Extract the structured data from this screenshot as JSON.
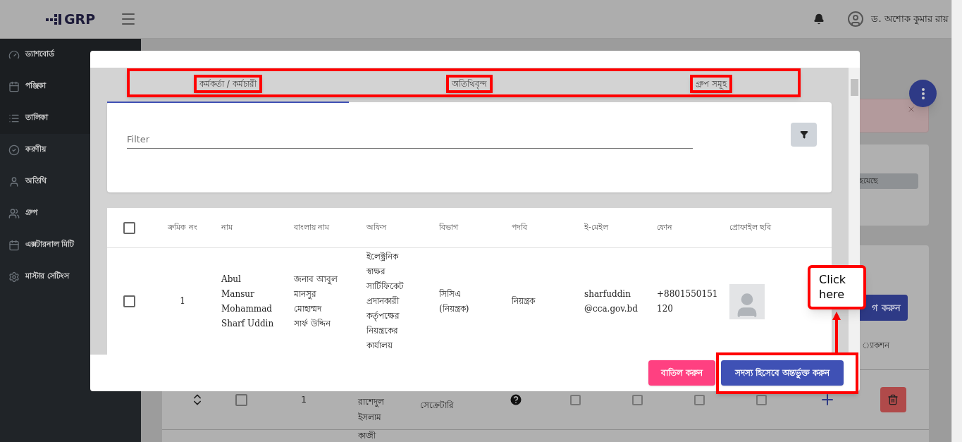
{
  "header": {
    "logo": "GRP",
    "user_name": "ড. অশোক কুমার রায়"
  },
  "sidebar": {
    "items": [
      {
        "label": "ড্যাশবোর্ড",
        "kind": "gauge"
      },
      {
        "label": "পঞ্জিকা",
        "kind": "calendar"
      },
      {
        "label": "তালিকা",
        "kind": "list"
      },
      {
        "label": "করণীয়",
        "kind": "check"
      },
      {
        "label": "অতিথি",
        "kind": "user"
      },
      {
        "label": "গ্রুপ",
        "kind": "users"
      },
      {
        "label": "এক্সটারনাল মিটি",
        "kind": "calendar"
      },
      {
        "label": "মাস্টার সেটিংস",
        "kind": "settings"
      }
    ]
  },
  "background": {
    "status_label": "হয়েছে",
    "button": "গ করুন",
    "column": "্যাকশন",
    "rows": [
      {
        "serial": "1",
        "name": "রাশেদুল\nইসলাম",
        "designation": "সেক্রেটারি",
        "checked": false,
        "flags": [
          false,
          false,
          false,
          false
        ]
      },
      {
        "name": "কাজী"
      }
    ]
  },
  "modal": {
    "tabs": [
      {
        "label": "কর্মকর্তা / কর্মচারী",
        "selected": true
      },
      {
        "label": "অতিথিবৃন্দ",
        "selected": false
      },
      {
        "label": "গ্রুপ সমূহ",
        "selected": false
      }
    ],
    "filter": {
      "placeholder": "Filter"
    },
    "table": {
      "all_checked": false,
      "columns": [
        "ক্রমিক নং",
        "নাম",
        "বাংলায় নাম",
        "অফিস",
        "বিভাগ",
        "পদবি",
        "ই-মেইল",
        "ফোন",
        "প্রোফাইল ছবি"
      ],
      "rows": [
        {
          "checked": false,
          "cells": [
            "1",
            "Abul\nMansur\nMohammad\nSharf Uddin",
            "জনাব আবুল\nমানসুর\nমোহাম্মদ\nসার্ফ উদ্দিন",
            "ইলেক্ট্রনিক\nস্বাক্ষর\nসার্টিফিকেট\nপ্রদানকারী\nকর্তৃপক্ষের\nনিয়ন্ত্রকের\nকার্যালয়",
            "সিসিএ\n(নিয়ন্ত্রক)",
            "নিয়ন্ত্রক",
            "sharfuddin\n@cca.gov.bd",
            "+8801550151\n120"
          ]
        }
      ]
    },
    "buttons": [
      {
        "label": "বাতিল করুন",
        "kind": "cancel"
      },
      {
        "label": "সদস্য হিসেবে অন্তর্ভুক্ত করুন",
        "kind": "primary"
      }
    ]
  },
  "annotation": {
    "callout": "Click here"
  }
}
